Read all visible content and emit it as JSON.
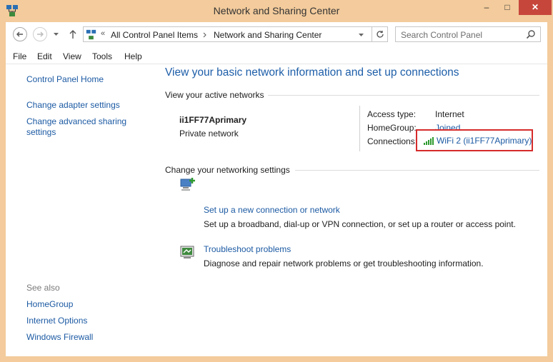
{
  "window": {
    "title": "Network and Sharing Center",
    "controls": {
      "minimize": "–",
      "maximize": "□",
      "close": "✕"
    }
  },
  "address": {
    "crumbs": [
      "All Control Panel Items",
      "Network and Sharing Center"
    ],
    "overflow": "«",
    "search_placeholder": "Search Control Panel"
  },
  "menu": [
    "File",
    "Edit",
    "View",
    "Tools",
    "Help"
  ],
  "sidebar": {
    "items": [
      "Control Panel Home",
      "Change adapter settings",
      "Change advanced sharing",
      "settings"
    ],
    "see_also_label": "See also",
    "see_also": [
      "HomeGroup",
      "Internet Options",
      "Windows Firewall"
    ]
  },
  "main": {
    "heading": "View your basic network information and set up connections",
    "active_networks_label": "View your active networks",
    "network": {
      "name": "ii1FF77Aprimary",
      "type": "Private network"
    },
    "properties": {
      "access_type_label": "Access type:",
      "access_type_value": "Internet",
      "homegroup_label": "HomeGroup:",
      "homegroup_value": "Joined",
      "connections_label": "Connections:",
      "connections_value": "WiFi 2 (ii1FF77Aprimary)"
    },
    "change_settings_label": "Change your networking settings",
    "tasks": [
      {
        "link": "Set up a new connection or network",
        "desc": "Set up a broadband, dial-up or VPN connection, or set up a router or access point."
      },
      {
        "link": "Troubleshoot problems",
        "desc": "Diagnose and repair network problems or get troubleshooting information."
      }
    ]
  },
  "colors": {
    "frame": "#f3cb9c",
    "close_button": "#c7463c",
    "link": "#1c5aa3",
    "heading": "#1d5ea8",
    "highlight_box": "#d62b2b",
    "signal": "#2e9a2e"
  }
}
